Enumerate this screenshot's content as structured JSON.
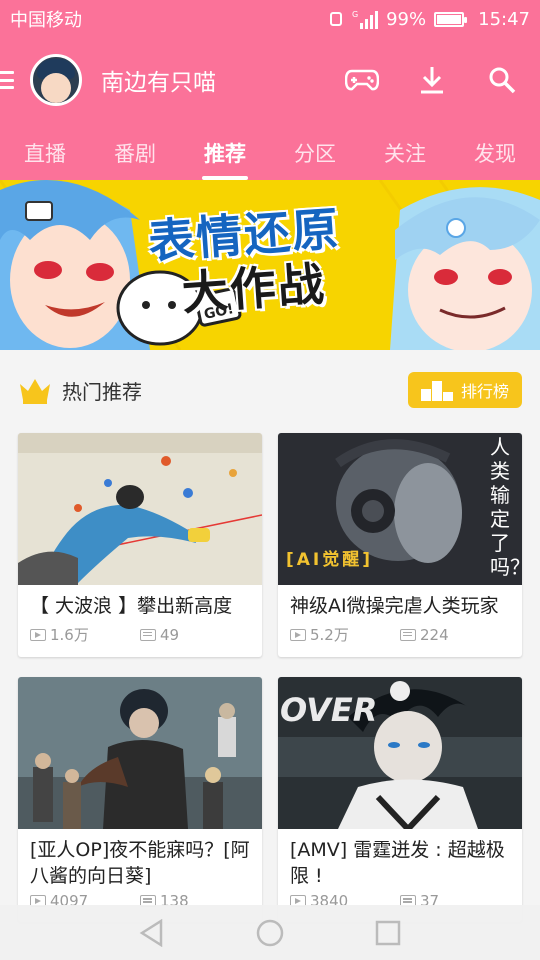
{
  "status": {
    "carrier": "中国移动",
    "battery": "99%",
    "time": "15:47",
    "signal_label": "G"
  },
  "header": {
    "username": "南边有只喵",
    "icons": [
      "menu-icon",
      "gamepad-icon",
      "download-icon",
      "search-icon"
    ]
  },
  "tabs": [
    {
      "label": "直播"
    },
    {
      "label": "番剧"
    },
    {
      "label": "推荐",
      "active": true
    },
    {
      "label": "分区"
    },
    {
      "label": "关注"
    },
    {
      "label": "发现"
    }
  ],
  "banner": {
    "title_line1": "表情还原",
    "title_line2": "大作战",
    "badge": "GO!"
  },
  "section": {
    "title": "热门推荐",
    "rank_label": "排行榜",
    "rank_icon_text": "1 2 3"
  },
  "cards": [
    {
      "title": "【 大波浪 】攀出新高度",
      "views": "1.6万",
      "comments": "49"
    },
    {
      "title": "神级AI微操完虐人类玩家",
      "views": "5.2万",
      "comments": "224",
      "thumb_tag": "[AI觉醒]",
      "thumb_side_text": "人类输定了吗？"
    },
    {
      "title": "[亚人OP]夜不能寐吗？[阿八酱的向日葵]",
      "views": "4097",
      "comments": "138"
    },
    {
      "title": "[AMV] 雷霆迸发 : 超越极限 !",
      "views": "3840",
      "comments": "37",
      "thumb_text": "OVER"
    }
  ],
  "colors": {
    "brand": "#fb7299",
    "rank": "#f7c51c",
    "banner": "#f7d400"
  }
}
